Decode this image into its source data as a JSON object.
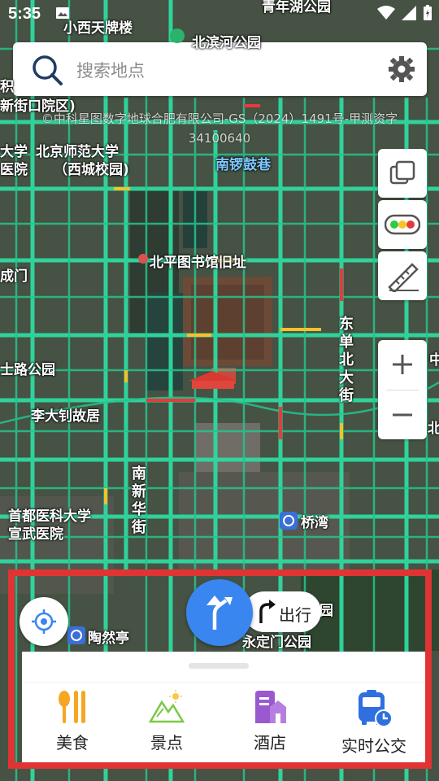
{
  "status_bar": {
    "time": "5:35"
  },
  "search": {
    "placeholder": "搜索地点"
  },
  "map": {
    "attribution_line1": "©中科星图数字地球合肥有限公司-GS（2024）1491号-甲测资字",
    "attribution_line2": "34100640",
    "labels": {
      "xiaoxi": "小西天牌楼",
      "qinghu": "青年湖公园",
      "beibinhe": "北滨河公园",
      "ji": "积",
      "xinjiekou": "新街口院区)",
      "daxue": "大学",
      "yiyuan": "医院",
      "bnu": "北京师范大学",
      "bnu_west": "（西城校园)",
      "nanluo": "南锣鼓巷",
      "library": "北平图书馆旧址",
      "chengmen": "成门",
      "shilu": "士路公园",
      "lidazhao": "李大钊故居",
      "shoudu": "首都医科大学",
      "xuanwu": "宣武医院",
      "qiaowan": "桥湾",
      "taoranting": "陶然亭",
      "yongdingmen": "永定门公园",
      "yuan": "园",
      "bei_edge": "北",
      "zhong_edge": "中"
    },
    "vertical_labels": {
      "dongdan": "东单北大街",
      "nanxinhua": "南新华街"
    }
  },
  "bottom": {
    "travel_label": "出行",
    "quick_items": [
      {
        "label": "美食",
        "icon": "food-icon",
        "color": "#f5a623"
      },
      {
        "label": "景点",
        "icon": "scenic-icon",
        "color": "#7ac943"
      },
      {
        "label": "酒店",
        "icon": "hotel-icon",
        "color": "#9b59d0"
      },
      {
        "label": "实时公交",
        "icon": "bus-icon",
        "color": "#2f6fe0"
      }
    ]
  },
  "colors": {
    "accent": "#3a86f0",
    "highlight_frame": "#e03434"
  }
}
